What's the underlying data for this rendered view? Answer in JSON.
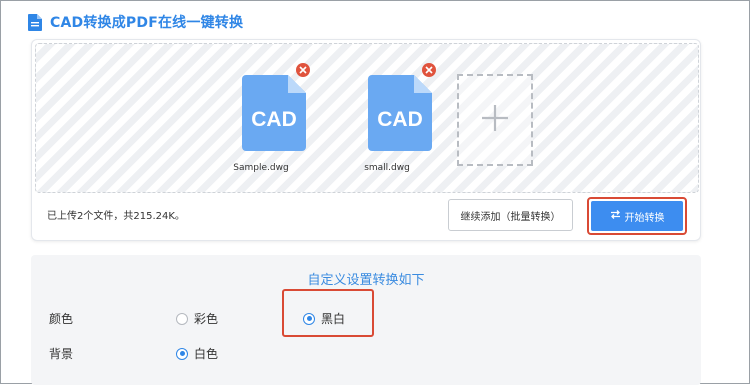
{
  "header": {
    "title": "CAD转换成PDF在线一键转换"
  },
  "files": [
    {
      "icon_text": "CAD",
      "name": "Sample.dwg"
    },
    {
      "icon_text": "CAD",
      "name": "small.dwg"
    }
  ],
  "upload": {
    "status": "已上传2个文件，共215.24K。",
    "add_more_label": "继续添加（批量转换）",
    "start_label": "开始转换"
  },
  "settings": {
    "title": "自定义设置转换如下",
    "color_label": "颜色",
    "color_options": [
      {
        "label": "彩色",
        "selected": false
      },
      {
        "label": "黑白",
        "selected": true
      }
    ],
    "background_label": "背景",
    "background_options": [
      {
        "label": "白色",
        "selected": true
      }
    ]
  },
  "colors": {
    "accent": "#2f86e6",
    "file_icon": "#6aa9f2",
    "highlight": "#d94a35",
    "delete": "#e0533d"
  },
  "icons": [
    "document-icon",
    "cad-file-icon",
    "delete-icon",
    "plus-icon",
    "convert-icon"
  ]
}
